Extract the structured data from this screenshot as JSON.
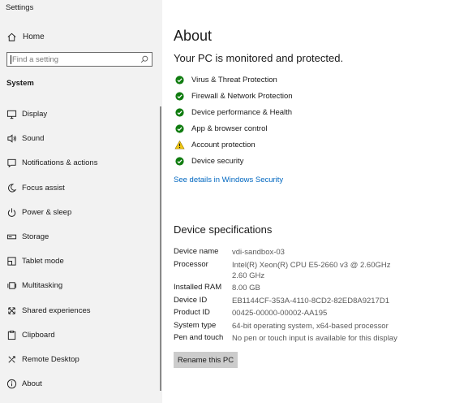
{
  "app": {
    "title": "Settings"
  },
  "sidebar": {
    "home_label": "Home",
    "search_placeholder": "Find a setting",
    "section": "System",
    "items": [
      {
        "label": "Display",
        "icon": "display-icon"
      },
      {
        "label": "Sound",
        "icon": "speaker-icon"
      },
      {
        "label": "Notifications & actions",
        "icon": "notification-icon"
      },
      {
        "label": "Focus assist",
        "icon": "moon-icon"
      },
      {
        "label": "Power & sleep",
        "icon": "power-icon"
      },
      {
        "label": "Storage",
        "icon": "storage-icon"
      },
      {
        "label": "Tablet mode",
        "icon": "tablet-icon"
      },
      {
        "label": "Multitasking",
        "icon": "multitasking-icon"
      },
      {
        "label": "Shared experiences",
        "icon": "shared-experiences-icon"
      },
      {
        "label": "Clipboard",
        "icon": "clipboard-icon"
      },
      {
        "label": "Remote Desktop",
        "icon": "remote-desktop-icon"
      },
      {
        "label": "About",
        "icon": "info-icon"
      }
    ]
  },
  "main": {
    "title": "About",
    "status": "Your PC is monitored and protected.",
    "protections": [
      {
        "label": "Virus & Threat Protection",
        "state": "ok"
      },
      {
        "label": "Firewall & Network Protection",
        "state": "ok"
      },
      {
        "label": "Device performance & Health",
        "state": "ok"
      },
      {
        "label": "App & browser control",
        "state": "ok"
      },
      {
        "label": "Account protection",
        "state": "warning"
      },
      {
        "label": "Device security",
        "state": "ok"
      }
    ],
    "security_link": "See details in Windows Security",
    "specs_title": "Device specifications",
    "specs": [
      {
        "key": "Device name",
        "value": "vdi-sandbox-03"
      },
      {
        "key": "Processor",
        "value": "Intel(R) Xeon(R) CPU E5-2660 v3 @ 2.60GHz   2.60 GHz"
      },
      {
        "key": "Installed RAM",
        "value": "8.00 GB"
      },
      {
        "key": "Device ID",
        "value": "EB1144CF-353A-4110-8CD2-82ED8A9217D1"
      },
      {
        "key": "Product ID",
        "value": "00425-00000-00002-AA195"
      },
      {
        "key": "System type",
        "value": "64-bit operating system, x64-based processor"
      },
      {
        "key": "Pen and touch",
        "value": "No pen or touch input is available for this display"
      }
    ],
    "rename_label": "Rename this PC"
  },
  "colors": {
    "ok": "#107c10",
    "warning": "#f2c811",
    "link": "#0067c0",
    "sidebar_bg": "#f2f2f2"
  }
}
